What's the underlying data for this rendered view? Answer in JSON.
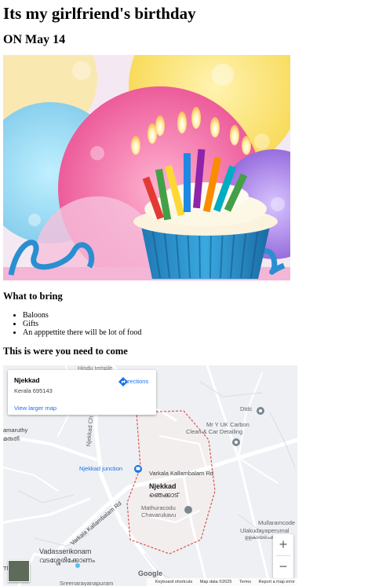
{
  "page": {
    "title": "Its my girlfriend's birthday",
    "date": "ON May 14",
    "cake_image_alt": "Cupcake with birthday candles"
  },
  "bring": {
    "heading": "What to bring",
    "items": [
      "Baloons",
      "Gifts",
      "An apppettite there will be lot of food"
    ]
  },
  "location": {
    "heading": "This is were you need to come"
  },
  "map": {
    "place_name": "Njekkad",
    "place_address": "Kerala 695143",
    "directions_label": "Directions",
    "view_larger": "View larger map",
    "labels": {
      "hindu_temple": "Hindu temple",
      "dtdc": "Dtdc",
      "carbon_1": "Mr Y UK Carbon",
      "carbon_2": "Clean & Car Detailing",
      "amaruthy": "amaruthy",
      "amaruthy_ml": "മരുതി",
      "njekkad_road": "Njekkad Ch",
      "junction": "Njekkad junction",
      "kallambalam": "Varkala Kallambalam Rd",
      "njekkad_center": "Njekkad",
      "njekkad_ml": "ഞെക്കാട്",
      "mathuracodu_1": "Mathuracodu",
      "mathuracodu_2": "Chavarukavu",
      "varkala_rd": "Varkala Kallambalam Rd",
      "mullaramcode_1": "Mullaramcode",
      "mullaramcode_2": "Ulakudayaperumal",
      "mullaramcode_3": "ഉളകുടയപെരു",
      "vadasserikonam": "Vadasserikonam",
      "vadasserikonam_ml": "വടശ്ശേരിക്കോണം",
      "sreenarayanapuram": "Sreenarayanapuram",
      "the_left": "The"
    },
    "zoom_in": "+",
    "zoom_out": "−",
    "google": "Google",
    "footer": {
      "shortcuts": "Keyboard shortcuts",
      "data": "Map data ©2025",
      "terms": "Terms",
      "report": "Report a map error"
    },
    "colors": {
      "boundary": "#d9534f",
      "link": "#1a73e8",
      "road": "#ffffff",
      "land": "#eef0f3"
    }
  }
}
